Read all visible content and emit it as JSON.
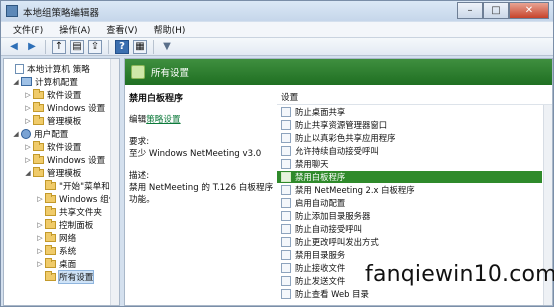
{
  "window": {
    "title": "本地组策略编辑器",
    "minimize": "–",
    "maximize": "□",
    "close": "✕"
  },
  "menu": [
    "文件(F)",
    "操作(A)",
    "查看(V)",
    "帮助(H)"
  ],
  "toolbar": {
    "back": "◀",
    "forward": "▶",
    "up": "↑",
    "show_hide": "▤",
    "export": "⇪",
    "help": "?",
    "properties": "▦",
    "filter": "▼"
  },
  "tree": {
    "items": [
      {
        "label": "本地计算机 策略",
        "icon": "doc-icon",
        "expander": ""
      },
      {
        "label": "计算机配置",
        "icon": "computer-icon",
        "expander": "◢"
      },
      {
        "label": "软件设置",
        "icon": "folder-icon",
        "expander": "▷"
      },
      {
        "label": "Windows 设置",
        "icon": "folder-icon",
        "expander": "▷"
      },
      {
        "label": "管理模板",
        "icon": "folder-icon",
        "expander": "▷"
      },
      {
        "label": "用户配置",
        "icon": "user-icon",
        "expander": "◢"
      },
      {
        "label": "软件设置",
        "icon": "folder-icon",
        "expander": "▷"
      },
      {
        "label": "Windows 设置",
        "icon": "folder-icon",
        "expander": "▷"
      },
      {
        "label": "管理模板",
        "icon": "folder-icon",
        "expander": "◢"
      },
      {
        "label": "\"开始\"菜单和",
        "icon": "folder-icon",
        "expander": ""
      },
      {
        "label": "Windows 组件",
        "icon": "folder-icon",
        "expander": "▷"
      },
      {
        "label": "共享文件夹",
        "icon": "folder-icon",
        "expander": ""
      },
      {
        "label": "控制面板",
        "icon": "folder-icon",
        "expander": "▷"
      },
      {
        "label": "网络",
        "icon": "folder-icon",
        "expander": "▷"
      },
      {
        "label": "系统",
        "icon": "folder-icon",
        "expander": "▷"
      },
      {
        "label": "桌面",
        "icon": "folder-icon",
        "expander": "▷"
      },
      {
        "label": "所有设置",
        "icon": "folder-icon",
        "expander": ""
      }
    ]
  },
  "main": {
    "header": "所有设置",
    "desc_title": "禁用白板程序",
    "edit_prefix": "编辑",
    "edit_link": "策略设置",
    "requirement_label": "要求:",
    "requirement_value": "至少 Windows NetMeeting v3.0",
    "description_label": "描述:",
    "description_line1": "禁用 NetMeeting 的 T.126 白板程序",
    "description_line2": "功能。",
    "column_header": "设置",
    "rows": [
      "防止桌面共享",
      "防止共享资源管理器窗口",
      "防止以真彩色共享应用程序",
      "允许持续自动接受呼叫",
      "禁用聊天",
      "禁用白板程序",
      "禁用 NetMeeting 2.x 白板程序",
      "启用自动配置",
      "防止添加目录服务器",
      "防止自动接受呼叫",
      "防止更改呼叫发出方式",
      "禁用目录服务",
      "防止接收文件",
      "防止发送文件",
      "防止查看 Web 目录"
    ],
    "selected_row": "禁用白板程序"
  },
  "watermark": "fanqiewin10.com"
}
